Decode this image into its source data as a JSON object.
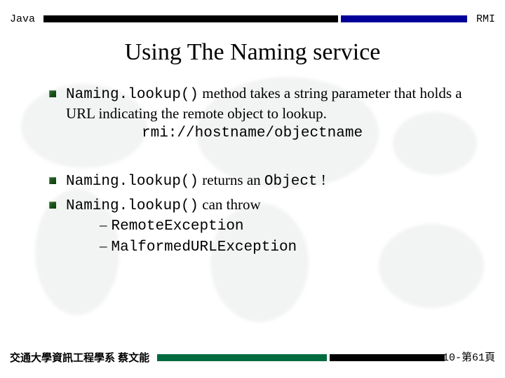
{
  "header": {
    "left": "Java",
    "right": "RMI"
  },
  "title": "Using The Naming service",
  "body": {
    "p1_code": "Naming.lookup()",
    "p1_rest": " method takes a string parameter that holds a URL indicating the remote object to lookup.",
    "p1_url": "rmi://hostname/objectname",
    "p2_code": "Naming.lookup()",
    "p2_rest": " returns an ",
    "p2_obj": "Object",
    "p2_excl": " !",
    "p3_code": "Naming.lookup()",
    "p3_rest": " can throw",
    "exc1": "RemoteException",
    "exc2": "MalformedURLException",
    "dash": "–"
  },
  "footer": {
    "left": "交通大學資訊工程學系 蔡文能",
    "right": "10-第61頁"
  }
}
